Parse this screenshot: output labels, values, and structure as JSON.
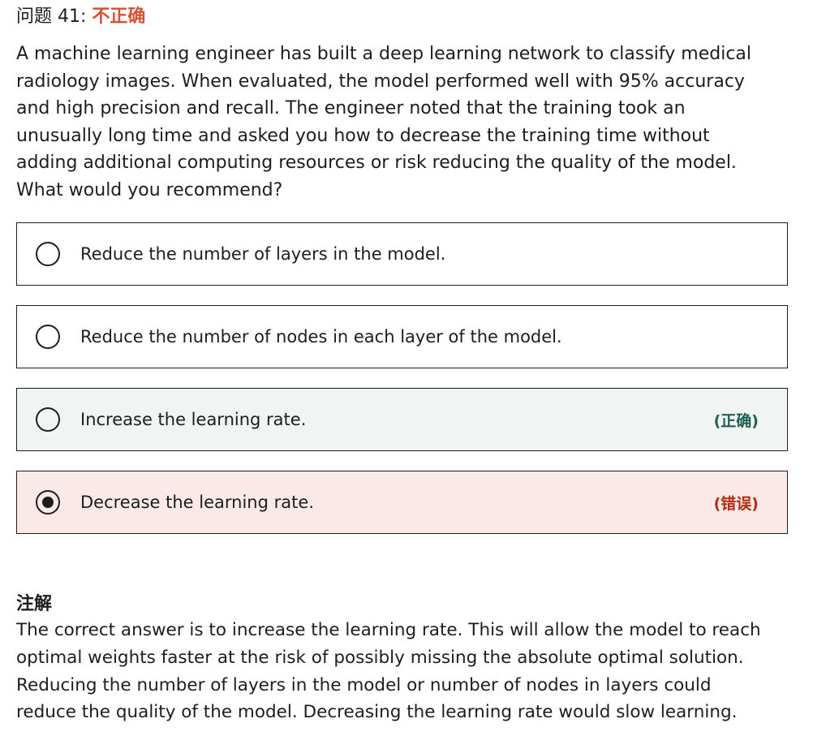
{
  "header": {
    "question_label": "问题 41:",
    "result_label": "不正确"
  },
  "question": {
    "text": "A machine learning engineer has built a deep learning network to classify medical radiology images.  When evaluated, the model performed well with 95% accuracy and high precision and recall.  The engineer noted that the training took an unusually long time and asked you how to decrease the training time without adding additional computing resources or risk reducing the quality of the model. What would you recommend?"
  },
  "options": [
    {
      "label": "Reduce the number of layers in the model.",
      "tag": "",
      "selected": false,
      "status": "neutral"
    },
    {
      "label": "Reduce the number of nodes in each layer of the model.",
      "tag": "",
      "selected": false,
      "status": "neutral"
    },
    {
      "label": "Increase the learning rate.",
      "tag": "(正确)",
      "selected": false,
      "status": "correct"
    },
    {
      "label": "Decrease the learning rate.",
      "tag": "(错误)",
      "selected": true,
      "status": "wrong"
    }
  ],
  "explanation": {
    "title": "注解",
    "text": "The correct answer is to increase the learning rate. This will allow the model to reach optimal weights faster at the risk of possibly missing the absolute optimal solution. Reducing the number of layers in the model or number of nodes in layers could reduce the quality of the model. Decreasing the learning rate would slow learning."
  },
  "colors": {
    "incorrect_accent": "#d9502f",
    "correct_bg": "#f0f5f3",
    "wrong_bg": "#fbe9e7",
    "correct_tag": "#1e6055",
    "wrong_tag": "#b32d0f"
  },
  "icons": {
    "radio_unselected": "radio-empty-icon",
    "radio_selected": "radio-selected-icon"
  }
}
